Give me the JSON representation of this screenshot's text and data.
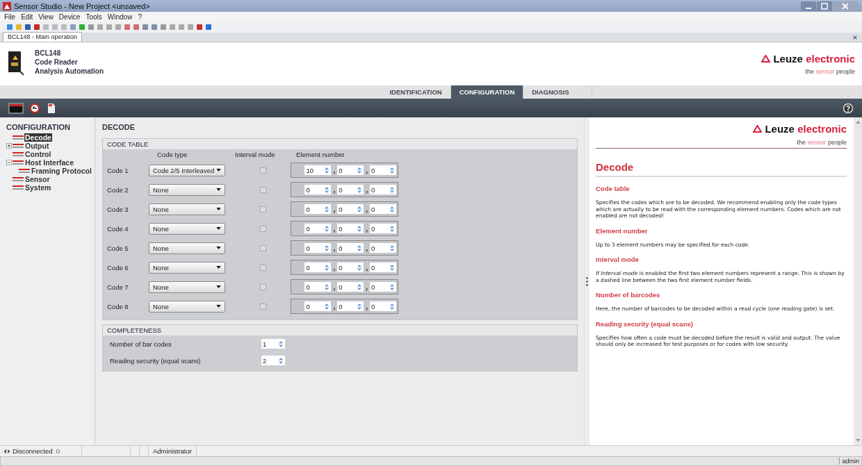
{
  "window": {
    "title": "Sensor Studio - New Project  <unsaved>"
  },
  "menu": [
    "File",
    "Edit",
    "View",
    "Device",
    "Tools",
    "Window",
    "?"
  ],
  "document_tab": {
    "label": "BCL148 - Main operation"
  },
  "device": {
    "name": "BCL148",
    "type": "Code Reader",
    "subtitle": "Analysis Automation"
  },
  "header_logo": {
    "brand": "Leuze",
    "brand_accent": "electronic",
    "tagline": "the",
    "tagline_accent": "sensor",
    "tagline_end": "people"
  },
  "tabs": [
    {
      "label": "IDENTIFICATION",
      "selected": false
    },
    {
      "label": "CONFIGURATION",
      "selected": true
    },
    {
      "label": "DIAGNOSIS",
      "selected": false
    }
  ],
  "sidebar": {
    "title": "CONFIGURATION",
    "items": [
      {
        "label": "Decode",
        "selected": true,
        "kind": "leaf"
      },
      {
        "label": "Output",
        "selected": false,
        "kind": "branch",
        "expanded": false
      },
      {
        "label": "Control",
        "selected": false,
        "kind": "leaf"
      },
      {
        "label": "Host Interface",
        "selected": false,
        "kind": "branch",
        "expanded": true,
        "children": [
          {
            "label": "Framing Protocol",
            "selected": false
          }
        ]
      },
      {
        "label": "Sensor",
        "selected": false,
        "kind": "leaf"
      },
      {
        "label": "System",
        "selected": false,
        "kind": "leaf"
      }
    ]
  },
  "page_title": "DECODE",
  "code_table": {
    "title": "CODE TABLE",
    "element_separator": ",",
    "columns": [
      "Code type",
      "Interval mode",
      "Element number"
    ],
    "rows": [
      {
        "label": "Code 1",
        "code_type": "Code 2/5 Interleaved",
        "interval_mode": false,
        "element_numbers": [
          "10",
          "0",
          "0"
        ]
      },
      {
        "label": "Code 2",
        "code_type": "None",
        "interval_mode": false,
        "element_numbers": [
          "0",
          "0",
          "0"
        ]
      },
      {
        "label": "Code 3",
        "code_type": "None",
        "interval_mode": false,
        "element_numbers": [
          "0",
          "0",
          "0"
        ]
      },
      {
        "label": "Code 4",
        "code_type": "None",
        "interval_mode": false,
        "element_numbers": [
          "0",
          "0",
          "0"
        ]
      },
      {
        "label": "Code 5",
        "code_type": "None",
        "interval_mode": false,
        "element_numbers": [
          "0",
          "0",
          "0"
        ]
      },
      {
        "label": "Code 6",
        "code_type": "None",
        "interval_mode": false,
        "element_numbers": [
          "0",
          "0",
          "0"
        ]
      },
      {
        "label": "Code 7",
        "code_type": "None",
        "interval_mode": false,
        "element_numbers": [
          "0",
          "0",
          "0"
        ]
      },
      {
        "label": "Code 8",
        "code_type": "None",
        "interval_mode": false,
        "element_numbers": [
          "0",
          "0",
          "0"
        ]
      }
    ]
  },
  "completeness": {
    "title": "COMPLETENESS",
    "fields": [
      {
        "label": "Number of bar codes",
        "value": "1"
      },
      {
        "label": "Reading security (equal scans)",
        "value": "2"
      }
    ]
  },
  "help": {
    "logo": {
      "brand": "Leuze",
      "brand_accent": "electronic",
      "tagline": "the",
      "tagline_accent": "sensor",
      "tagline_end": "people"
    },
    "title": "Decode",
    "sections": [
      {
        "heading": "Code table",
        "text": "Specifies the codes which are to be decoded. We recommend enabling only the code types which are actually to be read with the corresponding element numbers. Codes which are not enabled are not decoded!"
      },
      {
        "heading": "Element number",
        "text": "Up to 3 element numbers may be specified for each code."
      },
      {
        "heading": "Interval mode",
        "text": "If *Interval mode* is enabled the first two element numbers represent a range. This is shown by a dashed line between the two first element number fields."
      },
      {
        "heading": "Number of barcodes",
        "text": "Here, the number of barcodes to be decoded within a read cycle (one reading gate) is set."
      },
      {
        "heading": "Reading security (equal scans)",
        "text": "Specifies how often a code must be decoded before the result is valid and output. The value should only be increased for test purposes or for codes with low security."
      }
    ]
  },
  "status_bar": {
    "connection": "Disconnected",
    "user_role": "Administrator",
    "user": "admin"
  }
}
